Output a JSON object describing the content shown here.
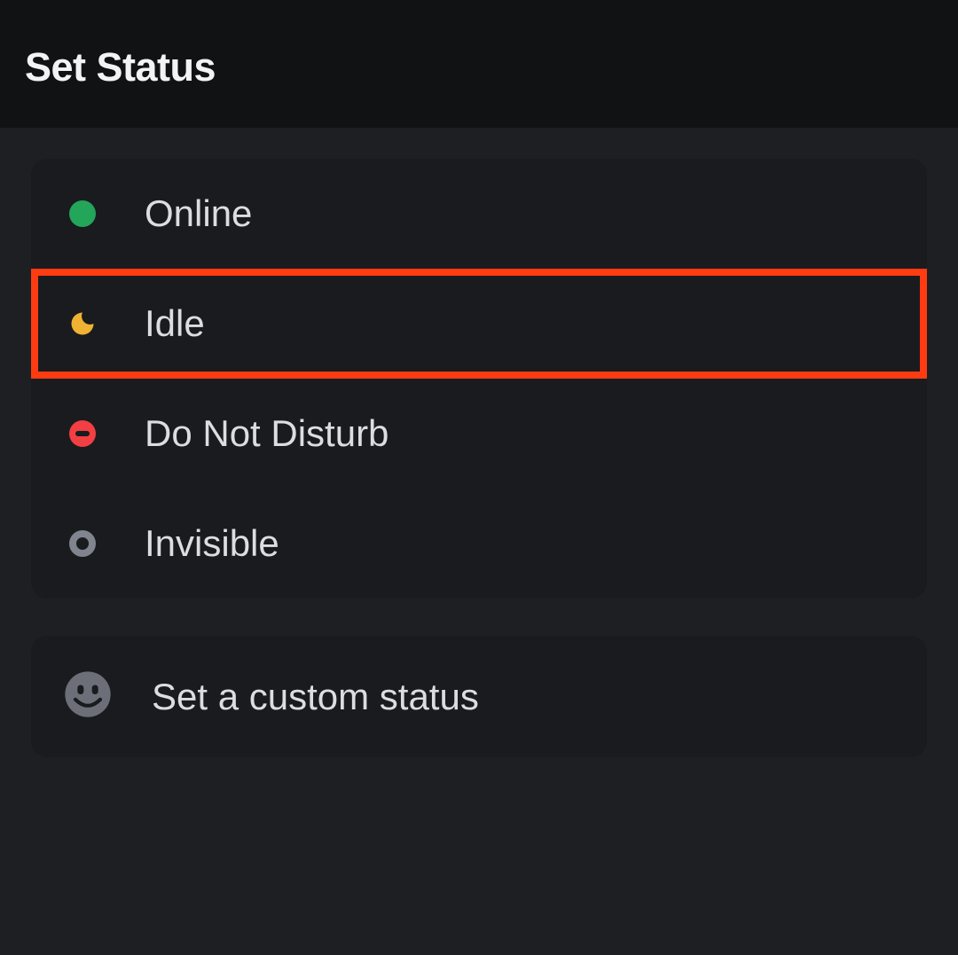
{
  "header": {
    "title": "Set Status"
  },
  "statusOptions": {
    "online": {
      "label": "Online"
    },
    "idle": {
      "label": "Idle",
      "highlighted": true
    },
    "dnd": {
      "label": "Do Not Disturb"
    },
    "invisible": {
      "label": "Invisible"
    }
  },
  "customStatus": {
    "label": "Set a custom status"
  },
  "colors": {
    "online": "#23a55a",
    "idle": "#f0b232",
    "dnd": "#f23f43",
    "invisible": "#80848e",
    "highlight": "#ff3b12",
    "smiley": "#6d6f78"
  }
}
